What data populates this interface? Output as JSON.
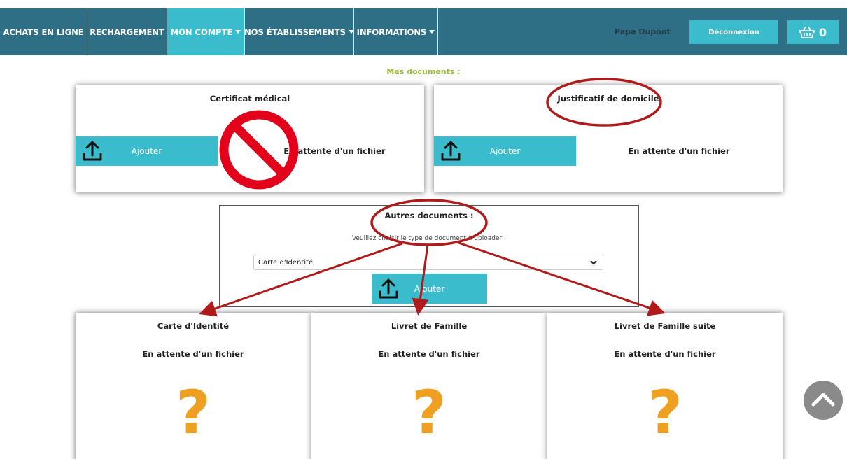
{
  "nav": {
    "items": [
      {
        "label": "ACHATS EN LIGNE"
      },
      {
        "label": "RECHARGEMENT"
      },
      {
        "label": "MON COMPTE"
      },
      {
        "label": "NOS ÉTABLISSEMENTS"
      },
      {
        "label": "INFORMATIONS"
      }
    ],
    "user": "Papa Dupont",
    "logout": "Déconnexion",
    "cart_count": "0"
  },
  "colors": {
    "nav_bg": "#2f6f86",
    "accent": "#3bbccc",
    "section_title": "#9ab93a",
    "question_mark": "#f0a020",
    "annotation": "#b01a1a"
  },
  "page": {
    "section_title": "Mes documents :"
  },
  "top_cards": [
    {
      "title": "Certificat médical",
      "button": "Ajouter",
      "status": "En attente d'un fichier"
    },
    {
      "title": "Justificatif de domicile",
      "button": "Ajouter",
      "status": "En attente d'un fichier"
    }
  ],
  "other": {
    "title": "Autres documents :",
    "helper": "Veuillez choisir le type de document à uploader :",
    "selected": "Carte d'Identité",
    "button": "Ajouter"
  },
  "bottom_cards": [
    {
      "title": "Carte d'Identité",
      "status": "En attente d'un fichier",
      "icon": "?"
    },
    {
      "title": "Livret de Famille",
      "status": "En attente d'un fichier",
      "icon": "?"
    },
    {
      "title": "Livret de Famille suite",
      "status": "En attente d'un fichier",
      "icon": "?"
    }
  ]
}
